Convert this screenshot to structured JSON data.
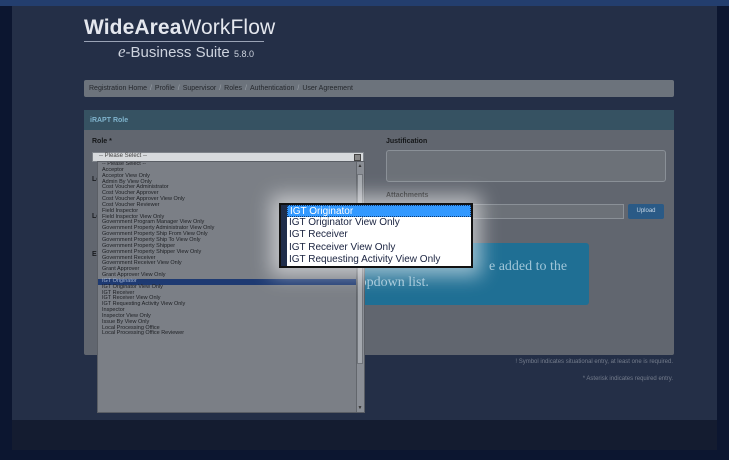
{
  "logo": {
    "brand_bold": "WideArea",
    "brand_rest": "WorkFlow",
    "e": "e",
    "product": "-Business Suite",
    "version": "5.8.0"
  },
  "nav": {
    "items": [
      "Registration Home",
      "Profile",
      "Supervisor",
      "Roles",
      "Authentication",
      "User Agreement"
    ],
    "separator": "/"
  },
  "panel": {
    "title": "iRAPT Role",
    "role_label": "Role *",
    "role_placeholder": "-- Please Select --",
    "justification_label": "Justification",
    "attachments_label": "Attachments",
    "upload_label": "Upload",
    "peek_lo": "Lo",
    "peek_el": "El"
  },
  "callout": {
    "line1": "e added to the",
    "line2": "Role dropdown list."
  },
  "notes": {
    "symbol_note": "! Symbol indicates situational entry, at least one is required.",
    "asterisk_note": "* Asterisk indicates required entry."
  },
  "dropdown": {
    "items": [
      "-- Please Select --",
      "Acceptor",
      "Acceptor View Only",
      "Admin By View Only",
      "Cost Voucher Administrator",
      "Cost Voucher Approver",
      "Cost Voucher Approver View Only",
      "Cost Voucher Reviewer",
      "Field Inspector",
      "Field Inspector View Only",
      "Government Program Manager View Only",
      "Government Property Administrator View Only",
      "Government Property Ship From View Only",
      "Government Property Ship To View Only",
      "Government Property Shipper",
      "Government Property Shipper View Only",
      "Government Receiver",
      "Government Receiver View Only",
      "Grant Approver",
      "Grant Approver View Only",
      "IGT Originator",
      "IGT Originator View Only",
      "IGT Receiver",
      "IGT Receiver View Only",
      "IGT Requesting Activity View Only",
      "Inspector",
      "Inspector View Only",
      "Issue By View Only",
      "Local Processing Office",
      "Local Processing Office Reviewer"
    ],
    "selected": "IGT Originator"
  },
  "magnifier": {
    "items": [
      "IGT Originator",
      "IGT Originator View Only",
      "IGT Receiver",
      "IGT Receiver View Only",
      "IGT Requesting Activity View Only"
    ]
  }
}
